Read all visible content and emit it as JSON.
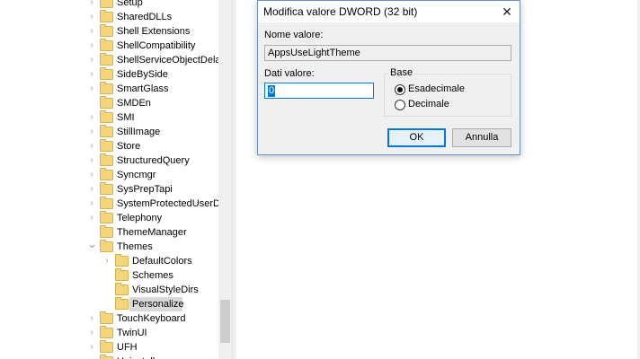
{
  "tree": {
    "items": [
      {
        "label": "Setup",
        "indent": 0,
        "expander": "collapsed"
      },
      {
        "label": "SharedDLLs",
        "indent": 0,
        "expander": "collapsed"
      },
      {
        "label": "Shell Extensions",
        "indent": 0,
        "expander": "collapsed"
      },
      {
        "label": "ShellCompatibility",
        "indent": 0,
        "expander": "collapsed"
      },
      {
        "label": "ShellServiceObjectDelayl",
        "indent": 0,
        "expander": "collapsed"
      },
      {
        "label": "SideBySide",
        "indent": 0,
        "expander": "collapsed"
      },
      {
        "label": "SmartGlass",
        "indent": 0,
        "expander": "collapsed"
      },
      {
        "label": "SMDEn",
        "indent": 0,
        "expander": "none"
      },
      {
        "label": "SMI",
        "indent": 0,
        "expander": "collapsed"
      },
      {
        "label": "StillImage",
        "indent": 0,
        "expander": "collapsed"
      },
      {
        "label": "Store",
        "indent": 0,
        "expander": "collapsed"
      },
      {
        "label": "StructuredQuery",
        "indent": 0,
        "expander": "collapsed"
      },
      {
        "label": "Syncmgr",
        "indent": 0,
        "expander": "collapsed"
      },
      {
        "label": "SysPrepTapi",
        "indent": 0,
        "expander": "collapsed"
      },
      {
        "label": "SystemProtectedUserDat",
        "indent": 0,
        "expander": "collapsed"
      },
      {
        "label": "Telephony",
        "indent": 0,
        "expander": "collapsed"
      },
      {
        "label": "ThemeManager",
        "indent": 0,
        "expander": "none"
      },
      {
        "label": "Themes",
        "indent": 0,
        "expander": "expanded"
      },
      {
        "label": "DefaultColors",
        "indent": 1,
        "expander": "collapsed"
      },
      {
        "label": "Schemes",
        "indent": 1,
        "expander": "none"
      },
      {
        "label": "VisualStyleDirs",
        "indent": 1,
        "expander": "none"
      },
      {
        "label": "Personalize",
        "indent": 1,
        "expander": "none",
        "selected": true
      },
      {
        "label": "TouchKeyboard",
        "indent": 0,
        "expander": "collapsed"
      },
      {
        "label": "TwinUI",
        "indent": 0,
        "expander": "collapsed"
      },
      {
        "label": "UFH",
        "indent": 0,
        "expander": "collapsed"
      },
      {
        "label": "Uninstall",
        "indent": 0,
        "expander": "collapsed"
      }
    ]
  },
  "dialog": {
    "title": "Modifica valore DWORD (32 bit)",
    "close_glyph": "✕",
    "value_name_label": "Nome valore:",
    "value_name": "AppsUseLightTheme",
    "value_data_label": "Dati valore:",
    "value_data": "0",
    "base_label": "Base",
    "radio_hex_label": "Esadecimale",
    "radio_dec_label": "Decimale",
    "radio_selected": "hex",
    "ok_label": "OK",
    "cancel_label": "Annulla"
  },
  "icons": {
    "folder": "folder-icon",
    "expander_collapsed": "chevron-right-icon",
    "expander_expanded": "chevron-down-icon"
  },
  "colors": {
    "folder_fill": "#f5d57a",
    "selection": "#d9d9d9",
    "accent": "#0078d7"
  }
}
